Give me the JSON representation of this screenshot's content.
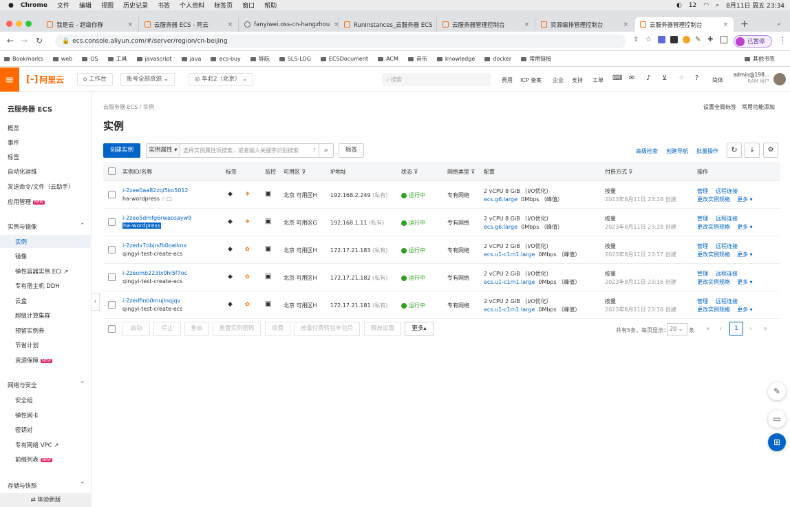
{
  "menubar": {
    "items": [
      "Chrome",
      "文件",
      "编辑",
      "视图",
      "历史记录",
      "书签",
      "个人资料",
      "标签页",
      "窗口",
      "帮助"
    ],
    "clock": "8月11日 周五 23:34",
    "battery_label": "12"
  },
  "tabs": [
    {
      "title": "我是云 - 超级你群"
    },
    {
      "title": "云服务器 ECS - 阿云"
    },
    {
      "title": "fanyiwei.oss-cn-hangzhou"
    },
    {
      "title": "RunInstances_云服务器 ECS"
    },
    {
      "title": "云服务器管理控制台"
    },
    {
      "title": "资源编排管理控制台"
    },
    {
      "title": "云服务器管理控制台"
    }
  ],
  "url": "ecs.console.aliyun.com/#/server/region/cn-beijing",
  "profile_label": "已暂停",
  "bookmarks": [
    "Bookmarks",
    "web",
    "OS",
    "工具",
    "javascript",
    "java",
    "ecs-buy",
    "导航",
    "SLS-LOG",
    "ECSDocument",
    "ACM",
    "音乐",
    "knowledge",
    "docker",
    "常用链接"
  ],
  "bookmarks_other": "其他书签",
  "header": {
    "logo": "阿里云",
    "workbench": "工作台",
    "account": "账号全部资源",
    "region": "华北2（北京）",
    "search_placeholder": "搜索",
    "links": [
      "费用",
      "ICP 备案",
      "企业",
      "支持",
      "工单"
    ],
    "lang": "简体",
    "user": "admin@198...",
    "user_sub": "RAM 用户"
  },
  "sidebar": {
    "title": "云服务器 ECS",
    "top_items": [
      "概览",
      "事件",
      "标签",
      "自动化运维",
      "发送命令/文件（云助手）",
      "应用管理"
    ],
    "section1": "实例与镜像",
    "section1_items": [
      "实例",
      "镜像",
      "弹性容器实例 ECI",
      "专有宿主机 DDH",
      "云盒",
      "超级计算集群",
      "预留实例券",
      "节省计划",
      "资源保障"
    ],
    "section2": "网络与安全",
    "section2_items": [
      "安全组",
      "弹性网卡",
      "密钥对",
      "专有网络 VPC",
      "前缀列表"
    ],
    "section3": "存储与快照",
    "footer": "体验新版",
    "new_badge": "NEW"
  },
  "page": {
    "breadcrumb": "云服务器 ECS / 实例",
    "top_right_1": "设置全局标签",
    "top_right_2": "常用功能添加",
    "title": "实例",
    "create_button": "创建实例",
    "filter_select": "实例属性",
    "search_placeholder": "选择实例属性项搜索，或者输入关键字识别搜索",
    "tag_button": "标签",
    "adv_search": "高级检索",
    "create_wizard": "创建导航",
    "batch_ops": "批量操作"
  },
  "table": {
    "headers": [
      "实例ID/名称",
      "标签",
      "",
      "监控",
      "可用区",
      "IP地址",
      "状态",
      "网络类型",
      "配置",
      "付费方式",
      "操作"
    ],
    "rows": [
      {
        "id": "i-2zee0aa82zqi5ko5012",
        "name": "ha-wordpress",
        "zone": "北京 可用区H",
        "ip": "192.168.2.249",
        "ip_type": "(私有)",
        "status": "运行中",
        "net": "专有网络",
        "cfg1": "2 vCPU 8 GiB （I/O优化）",
        "cfg_type": "ecs.g6.large",
        "cfg2": "0Mbps （峰值）",
        "pay": "按量",
        "time": "2023年8月11日 23:28 创建",
        "op1": "管理",
        "op2": "远程连接",
        "op3": "更改实例规格",
        "op4": "更多"
      },
      {
        "id": "i-2zeo5dmfg6rwaosayw9",
        "name": "ha-wordpress",
        "zone": "北京 可用区G",
        "ip": "192.168.1.11",
        "ip_type": "(私有)",
        "status": "运行中",
        "net": "专有网络",
        "cfg1": "2 vCPU 8 GiB （I/O优化）",
        "cfg_type": "ecs.g6.large",
        "cfg2": "0Mbps （峰值）",
        "pay": "按量",
        "time": "2023年8月11日 23:28 创建",
        "op1": "管理",
        "op2": "远程连接",
        "op3": "更改实例规格",
        "op4": "更多"
      },
      {
        "id": "i-2zedv7objrsfb0oeiknx",
        "name": "qingyi-test-create-ecs",
        "zone": "北京 可用区H",
        "ip": "172.17.21.183",
        "ip_type": "(私有)",
        "status": "运行中",
        "net": "专有网络",
        "cfg1": "2 vCPU 2 GiB （I/O优化）",
        "cfg_type": "ecs.u1-c1m1.large",
        "cfg2": "0Mbps （峰值）",
        "pay": "按量",
        "time": "2023年8月11日 23:17 创建",
        "op1": "管理",
        "op2": "远程连接",
        "op3": "更改实例规格",
        "op4": "更多"
      },
      {
        "id": "i-2zeomb223lx0hi5f7oc",
        "name": "qingyi-test-create-ecs",
        "zone": "北京 可用区H",
        "ip": "172.17.21.182",
        "ip_type": "(私有)",
        "status": "运行中",
        "net": "专有网络",
        "cfg1": "2 vCPU 2 GiB （I/O优化）",
        "cfg_type": "ecs.u1-c1m1.large",
        "cfg2": "0Mbps （峰值）",
        "pay": "按量",
        "time": "2023年8月11日 23:16 创建",
        "op1": "管理",
        "op2": "远程连接",
        "op3": "更改实例规格",
        "op4": "更多"
      },
      {
        "id": "i-2zedfinb0mujlnqjqv",
        "name": "qingyi-test-create-ecs",
        "zone": "北京 可用区H",
        "ip": "172.17.21.181",
        "ip_type": "(私有)",
        "status": "运行中",
        "net": "专有网络",
        "cfg1": "2 vCPU 2 GiB （I/O优化）",
        "cfg_type": "ecs.u1-c1m1.large",
        "cfg2": "0Mbps （峰值）",
        "pay": "按量",
        "time": "2023年8月11日 23:16 创建",
        "op1": "管理",
        "op2": "远程连接",
        "op3": "更改实例规格",
        "op4": "更多"
      }
    ]
  },
  "footer_bar": {
    "buttons": [
      "启动",
      "停止",
      "重启",
      "重置实例密码",
      "续费",
      "按量付费转包年包月",
      "释放设置",
      "更多"
    ],
    "total": "共有5条，每页显示：",
    "page_size": "20",
    "unit": "条",
    "page": "1"
  },
  "colors": {
    "brand": "#ff6a00",
    "primary": "#0064c8",
    "running": "#2ea121"
  }
}
